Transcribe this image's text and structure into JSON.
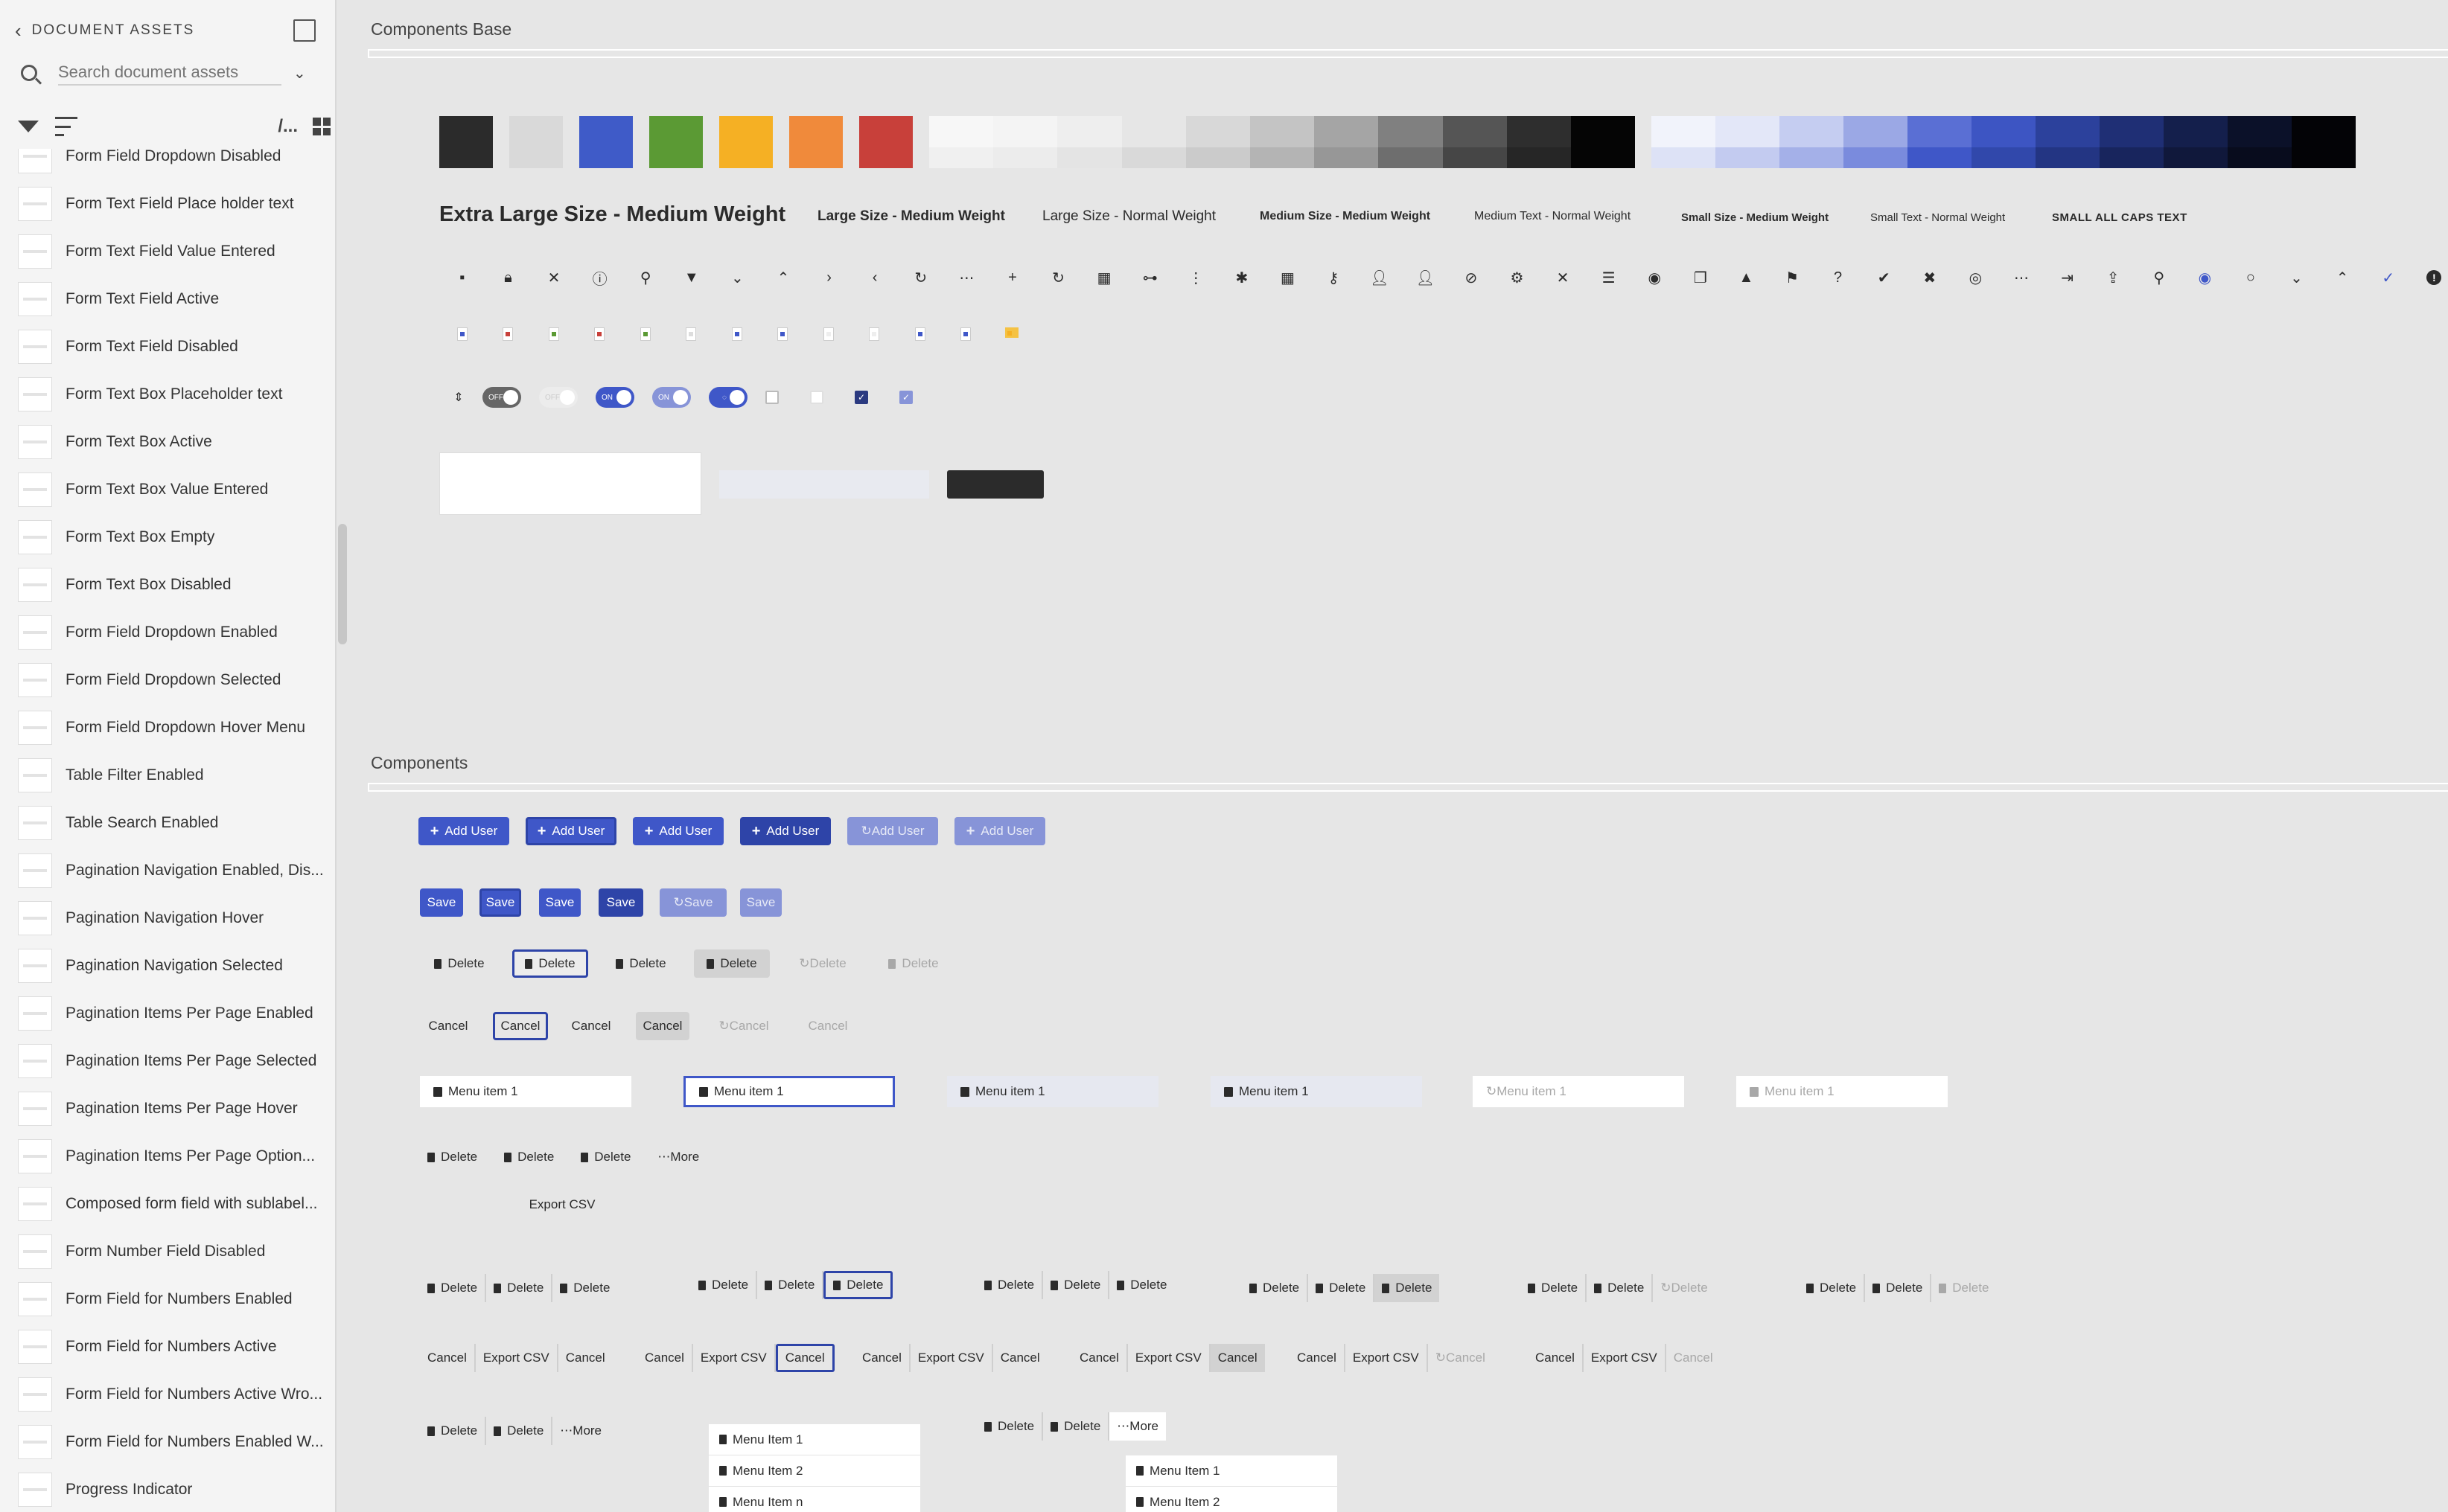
{
  "sidebar": {
    "title": "DOCUMENT ASSETS",
    "search_placeholder": "Search document assets",
    "items": [
      "Form Field Dropdown Disabled",
      "Form Text Field Place holder text",
      "Form Text Field Value Entered",
      "Form Text Field Active",
      "Form Text Field Disabled",
      "Form Text Box Placeholder text",
      "Form Text Box Active",
      "Form Text Box Value Entered",
      "Form Text Box Empty",
      "Form Text Box Disabled",
      "Form Field Dropdown Enabled",
      "Form Field Dropdown Selected",
      "Form Field Dropdown Hover Menu",
      "Table Filter Enabled",
      "Table Search Enabled",
      "Pagination Navigation Enabled, Dis...",
      "Pagination Navigation Hover",
      "Pagination Navigation Selected",
      "Pagination Items Per Page Enabled",
      "Pagination Items Per Page Selected",
      "Pagination Items Per Page Hover",
      "Pagination Items Per Page Option...",
      "Composed form field with sublabel...",
      "Form Number Field Disabled",
      "Form Field for Numbers Enabled",
      "Form Field for Numbers Active",
      "Form Field for Numbers Active Wro...",
      "Form Field for Numbers Enabled W...",
      "Progress Indicator"
    ]
  },
  "sections": {
    "base": "Components Base",
    "components": "Components"
  },
  "swatches": [
    "#2b2b2b",
    "#d9d9d9",
    "#3f5bc8",
    "#5b9a34",
    "#f5b024",
    "#f08a3b",
    "#c8403a"
  ],
  "typography": [
    {
      "text": "Extra Large Size - Medium Weight",
      "size": 29,
      "weight": 500
    },
    {
      "text": "Large Size - Medium Weight",
      "size": 19,
      "weight": 500
    },
    {
      "text": "Large Size - Normal Weight",
      "size": 19,
      "weight": 400
    },
    {
      "text": "Medium Size - Medium Weight",
      "size": 16,
      "weight": 500
    },
    {
      "text": "Medium Text - Normal Weight",
      "size": 16,
      "weight": 400
    },
    {
      "text": "Small Size - Medium Weight",
      "size": 15,
      "weight": 500
    },
    {
      "text": "Small Text - Normal Weight",
      "size": 15,
      "weight": 400
    },
    {
      "text": "SMALL ALL CAPS TEXT",
      "size": 15,
      "weight": 500
    }
  ],
  "toggles": {
    "off": "OFF",
    "on": "ON"
  },
  "buttons": {
    "add_user": "Add User",
    "save": "Save",
    "delete": "Delete",
    "cancel": "Cancel",
    "menu_item": "Menu item 1",
    "more": "More",
    "export_csv": "Export CSV"
  },
  "dropdown_a": [
    "Menu Item 1",
    "Menu Item 2",
    "Menu Item n"
  ],
  "dropdown_b": [
    "Menu Item 1",
    "Menu Item 2"
  ]
}
